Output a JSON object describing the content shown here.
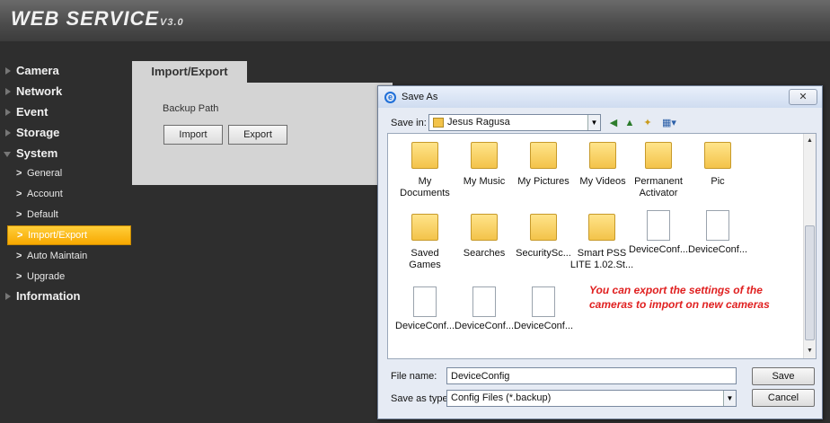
{
  "header": {
    "logo_text": "WEB  SERVICE",
    "logo_version": "V3.0"
  },
  "sidebar": {
    "sections": [
      {
        "label": "Camera"
      },
      {
        "label": "Network"
      },
      {
        "label": "Event"
      },
      {
        "label": "Storage"
      },
      {
        "label": "System"
      },
      {
        "label": "Information"
      }
    ],
    "system_items": [
      {
        "label": "General"
      },
      {
        "label": "Account"
      },
      {
        "label": "Default"
      },
      {
        "label": "Import/Export",
        "active": true
      },
      {
        "label": "Auto Maintain"
      },
      {
        "label": "Upgrade"
      }
    ],
    "chevron": ">"
  },
  "panel": {
    "tab_label": "Import/Export",
    "backup_path_label": "Backup Path",
    "import_label": "Import",
    "export_label": "Export"
  },
  "dialog": {
    "title": "Save As",
    "close_label": "✕",
    "save_in_label": "Save in:",
    "save_in_value": "Jesus Ragusa",
    "files": [
      {
        "label": "My Documents",
        "type": "folder"
      },
      {
        "label": "My Music",
        "type": "folder"
      },
      {
        "label": "My Pictures",
        "type": "folder"
      },
      {
        "label": "My Videos",
        "type": "folder"
      },
      {
        "label": "Permanent Activator",
        "type": "folder"
      },
      {
        "label": "Pic",
        "type": "folder"
      },
      {
        "label": "Saved Games",
        "type": "folder"
      },
      {
        "label": "Searches",
        "type": "folder"
      },
      {
        "label": "SecuritySc...",
        "type": "folder"
      },
      {
        "label": "Smart PSS LITE 1.02.St...",
        "type": "folder"
      },
      {
        "label": "DeviceConf...",
        "type": "doc"
      },
      {
        "label": "DeviceConf...",
        "type": "doc"
      },
      {
        "label": "DeviceConf...",
        "type": "doc"
      },
      {
        "label": "DeviceConf...",
        "type": "doc"
      },
      {
        "label": "DeviceConf...",
        "type": "doc"
      }
    ],
    "annotation": "You can export the settings of the cameras to import on new cameras",
    "file_name_label": "File name:",
    "file_name_value": "DeviceConfig",
    "save_as_type_label": "Save as type:",
    "save_as_type_value": "Config Files (*.backup)",
    "save_label": "Save",
    "cancel_label": "Cancel"
  }
}
